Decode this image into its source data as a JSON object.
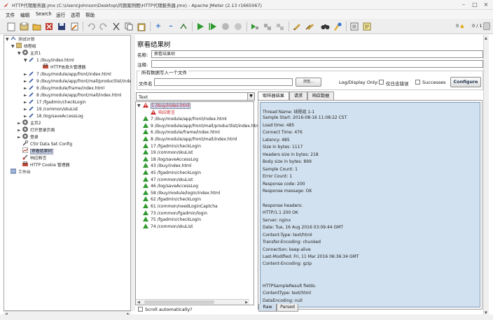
{
  "window": {
    "title": "HTTP代理服务器.jmx (C:\\Users\\Johnson\\Desktop\\问题案例图\\HTTP代理服务器.jmx) - Apache JMeter (2.13 r1665067)"
  },
  "menu": [
    "文件",
    "编辑",
    "Search",
    "运行",
    "选项",
    "帮助"
  ],
  "toolbar": {
    "warnings": "0",
    "threads": "0 / 1"
  },
  "tree": [
    {
      "label": "测试计划"
    },
    {
      "label": "线程组"
    },
    {
      "label": "主页1"
    },
    {
      "label": "1 /ibuy/index.html"
    },
    {
      "label": "HTTP信息头管理器"
    },
    {
      "label": "7 /ibuy/module/app/front/index.html"
    },
    {
      "label": "9 /ibuy/module/app/front/mall/productlist/index.l"
    },
    {
      "label": "6 /ibuy/module/frame/index.html"
    },
    {
      "label": "8 /ibuy/module/app/front/mall/index.html"
    },
    {
      "label": "17 /fgadmin/checkLogin"
    },
    {
      "label": "19 /common/skuList"
    },
    {
      "label": "18 /log/saveAccessLog"
    },
    {
      "label": "主页2"
    },
    {
      "label": "打开登录页面"
    },
    {
      "label": "登录"
    },
    {
      "label": "CSV Data Set Config"
    },
    {
      "label": "察看结果树"
    },
    {
      "label": "响应断言"
    },
    {
      "label": "HTTP Cookie 管理器"
    },
    {
      "label": "工作台"
    }
  ],
  "panel": {
    "title": "察看结果树",
    "name_label": "名称:",
    "name_value": "察看结果树",
    "comment_label": "注释:",
    "comment_value": "",
    "group_label": "所有数据写入一个文件",
    "filename_label": "文件名",
    "filename_value": "",
    "browse_label": "浏览...",
    "logdisplay_label": "Log/Display Only:",
    "errors_label": "仅日志错误",
    "successes_label": "Successes",
    "configure_label": "Configure"
  },
  "renderer": {
    "selected": "Text"
  },
  "results": [
    {
      "label": "1 /ibuy/index.html",
      "status": "error"
    },
    {
      "label": "响应断言",
      "status": "error"
    },
    {
      "label": "7 /ibuy/module/app/front/index.html",
      "status": "ok"
    },
    {
      "label": "9 /ibuy/module/app/front/mall/productlist/index.html",
      "status": "ok"
    },
    {
      "label": "6 /ibuy/module/frame/index.html",
      "status": "ok"
    },
    {
      "label": "8 /ibuy/module/app/front/mall/index.html",
      "status": "ok"
    },
    {
      "label": "17 /fgadmin/checkLogin",
      "status": "ok"
    },
    {
      "label": "19 /common/skuList",
      "status": "ok"
    },
    {
      "label": "18 /log/saveAccessLog",
      "status": "ok"
    },
    {
      "label": "43 /ibuy/index.html",
      "status": "ok"
    },
    {
      "label": "45 /fgadmin/checkLogin",
      "status": "ok"
    },
    {
      "label": "47 /common/skuList",
      "status": "ok"
    },
    {
      "label": "46 /log/saveAccessLog",
      "status": "ok"
    },
    {
      "label": "58 /ibuy/module/login/index.html",
      "status": "ok"
    },
    {
      "label": "62 /fgadmin/checkLogin",
      "status": "ok"
    },
    {
      "label": "61 /common/needLoginCaptcha",
      "status": "ok"
    },
    {
      "label": "73 /common/fgadmin/login",
      "status": "ok"
    },
    {
      "label": "75 /fgadmin/checkLogin",
      "status": "ok"
    },
    {
      "label": "74 /common/skuList",
      "status": "ok"
    }
  ],
  "scroll_label": "Scroll automatically?",
  "tabs": [
    "取样器结果",
    "请求",
    "响应数据"
  ],
  "bottom_tabs": [
    "Raw",
    "Parsed"
  ],
  "detail_lines": [
    "Thread Name: 线程组 1-1",
    "Sample Start: 2016-08-16 11:08:22 CST",
    "Load time: 485",
    "Connect Time: 476",
    "Latency: 485",
    "Size in bytes: 1117",
    "Headers size in bytes: 218",
    "Body size in bytes: 899",
    "Sample Count: 1",
    "Error Count: 1",
    "Response code: 200",
    "Response message: OK",
    "",
    "Response headers:",
    "HTTP/1.1 200 OK",
    "Server: nginx",
    "Date: Tue, 16 Aug 2016 03:09:44 GMT",
    "Content-Type: text/html",
    "Transfer-Encoding: chunked",
    "Connection: keep-alive",
    "Last-Modified: Fri, 11 Mar 2016 06:36:34 GMT",
    "Content-Encoding: gzip",
    "",
    "",
    "HTTPSampleResult fields:",
    "ContentType: text/html",
    "DataEncoding: null"
  ],
  "colors": {
    "error": "#cc2b2b",
    "success": "#2f9a2f",
    "selection": "#c7d2ec",
    "detail_bg": "#d2e1ef"
  }
}
